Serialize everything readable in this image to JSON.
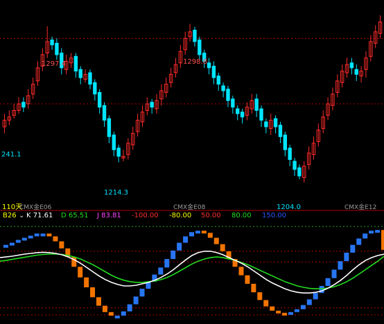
{
  "price_panel": {
    "labels": {
      "high_left": "1297.4",
      "high_mid": "1298.8",
      "low_left": "241.1",
      "low_mid": "1214.3",
      "low_right": "1204.0",
      "scale_label": "110天",
      "period_1": "CMX金E06",
      "period_2": "CMX金E08",
      "period_3": "CMX金E12"
    }
  },
  "indicator_panel": {
    "name": "B26",
    "k_label": "K 71.61",
    "d_label": "D 65.51",
    "j_label": "J 83.81",
    "levels": [
      "-100.00",
      "-80.00",
      "50.00",
      "80.00",
      "150.00"
    ]
  },
  "colors": {
    "background": "#000000",
    "up_candle": "#ff2b2b",
    "down_candle": "#00e5ff",
    "grid_red": "#b00000",
    "grid_green": "#2e9e2e",
    "k_line": "#ffffff",
    "d_line": "#22dd22",
    "j_up": "#2a7bff",
    "j_down": "#ff7a00",
    "label_red": "#ff5050",
    "label_cyan": "#00e5ff",
    "yellow": "#ffff00"
  },
  "chart_data": [
    {
      "type": "candlestick",
      "y_range": [
        1190,
        1310
      ],
      "reference_levels": [
        1290,
        1250
      ],
      "annotations": [
        {
          "text": "1297.4",
          "x": 18,
          "y": 1297.4
        },
        {
          "text": "1298.8",
          "x": 66,
          "y": 1298.8
        },
        {
          "text": "241.1",
          "x": 1,
          "y": 1241.1
        },
        {
          "text": "1214.3",
          "x": 41,
          "y": 1214.3
        },
        {
          "text": "1204.0",
          "x": 101,
          "y": 1204.0
        }
      ],
      "close": [
        1240,
        1242,
        1246,
        1250,
        1248,
        1255,
        1262,
        1272,
        1280,
        1288,
        1286,
        1280,
        1272,
        1276,
        1278,
        1270,
        1266,
        1268,
        1262,
        1256,
        1248,
        1240,
        1230,
        1222,
        1218,
        1218,
        1226,
        1232,
        1240,
        1245,
        1250,
        1248,
        1252,
        1258,
        1262,
        1268,
        1274,
        1282,
        1290,
        1294,
        1288,
        1280,
        1276,
        1272,
        1266,
        1262,
        1258,
        1252,
        1248,
        1244,
        1242,
        1248,
        1252,
        1246,
        1240,
        1236,
        1240,
        1236,
        1230,
        1222,
        1216,
        1210,
        1206,
        1212,
        1220,
        1226,
        1234,
        1242,
        1250,
        1256,
        1264,
        1270,
        1274,
        1272,
        1268,
        1270,
        1278,
        1288,
        1294,
        1300
      ],
      "open": [
        1236,
        1240,
        1243,
        1246,
        1251,
        1250,
        1256,
        1264,
        1273,
        1281,
        1289,
        1287,
        1281,
        1271,
        1275,
        1279,
        1271,
        1265,
        1269,
        1263,
        1257,
        1249,
        1241,
        1231,
        1223,
        1217,
        1219,
        1225,
        1233,
        1239,
        1246,
        1251,
        1247,
        1253,
        1257,
        1263,
        1269,
        1275,
        1283,
        1291,
        1295,
        1289,
        1281,
        1275,
        1273,
        1267,
        1261,
        1259,
        1253,
        1247,
        1245,
        1243,
        1247,
        1253,
        1247,
        1239,
        1235,
        1241,
        1237,
        1231,
        1223,
        1215,
        1211,
        1205,
        1213,
        1219,
        1227,
        1235,
        1243,
        1249,
        1257,
        1263,
        1269,
        1275,
        1271,
        1267,
        1271,
        1279,
        1287,
        1293
      ],
      "high": [
        1244,
        1246,
        1250,
        1254,
        1254,
        1259,
        1266,
        1276,
        1284,
        1297.4,
        1291,
        1290,
        1284,
        1280,
        1281,
        1281,
        1273,
        1271,
        1271,
        1265,
        1259,
        1251,
        1243,
        1233,
        1225,
        1222,
        1229,
        1236,
        1244,
        1249,
        1254,
        1253,
        1256,
        1262,
        1266,
        1272,
        1278,
        1286,
        1294,
        1298.8,
        1297,
        1291,
        1283,
        1278,
        1276,
        1269,
        1263,
        1261,
        1255,
        1249,
        1247,
        1251,
        1256,
        1256,
        1249,
        1241,
        1244,
        1243,
        1239,
        1233,
        1225,
        1217,
        1213,
        1215,
        1224,
        1230,
        1238,
        1246,
        1254,
        1260,
        1268,
        1274,
        1278,
        1278,
        1274,
        1273,
        1282,
        1292,
        1298,
        1304
      ],
      "low": [
        1232,
        1237,
        1241,
        1244,
        1245,
        1247,
        1253,
        1261,
        1270,
        1278,
        1283,
        1277,
        1268,
        1268,
        1272,
        1266,
        1262,
        1263,
        1259,
        1252,
        1244,
        1236,
        1226,
        1218,
        1214.3,
        1215,
        1216,
        1222,
        1230,
        1236,
        1243,
        1244,
        1244,
        1249,
        1254,
        1260,
        1266,
        1272,
        1280,
        1288,
        1285,
        1277,
        1272,
        1268,
        1262,
        1258,
        1254,
        1248,
        1244,
        1240,
        1238,
        1240,
        1244,
        1242,
        1236,
        1232,
        1231,
        1232,
        1226,
        1218,
        1212,
        1206,
        1204.0,
        1202,
        1210,
        1216,
        1224,
        1232,
        1240,
        1246,
        1254,
        1260,
        1266,
        1268,
        1264,
        1263,
        1266,
        1276,
        1284,
        1290
      ]
    },
    {
      "type": "line",
      "title": "B26",
      "y_range": [
        -110,
        160
      ],
      "reference_levels": [
        150,
        80,
        50,
        -80,
        -100
      ],
      "series": [
        {
          "name": "K",
          "last": 71.61,
          "values": [
            62,
            64,
            66,
            69,
            72,
            74,
            76,
            77,
            76,
            74,
            70,
            64,
            56,
            46,
            34,
            22,
            10,
            0,
            -8,
            -14,
            -18,
            -18,
            -16,
            -12,
            -8,
            -2,
            6,
            16,
            28,
            42,
            56,
            68,
            76,
            80,
            80,
            76,
            70,
            62,
            54,
            46,
            36,
            24,
            12,
            0,
            -10,
            -18,
            -26,
            -32,
            -36,
            -38,
            -38,
            -36,
            -32,
            -24,
            -14,
            -2,
            12,
            28,
            42,
            54,
            62,
            68,
            71.61
          ]
        },
        {
          "name": "D",
          "last": 65.51,
          "values": [
            52,
            54,
            57,
            60,
            63,
            66,
            69,
            71,
            72,
            72,
            71,
            68,
            64,
            58,
            50,
            42,
            32,
            22,
            12,
            4,
            -2,
            -6,
            -8,
            -8,
            -6,
            -4,
            0,
            6,
            14,
            24,
            34,
            44,
            52,
            58,
            62,
            64,
            62,
            58,
            54,
            48,
            42,
            34,
            26,
            18,
            10,
            2,
            -6,
            -12,
            -18,
            -22,
            -25,
            -26,
            -26,
            -24,
            -20,
            -14,
            -6,
            4,
            16,
            28,
            40,
            52,
            65.51
          ]
        },
        {
          "name": "J",
          "last": 83.81,
          "values": [
            90,
            98,
            104,
            112,
            118,
            124,
            130,
            130,
            122,
            108,
            88,
            64,
            36,
            6,
            -22,
            -50,
            -74,
            -92,
            -102,
            -102,
            -90,
            -70,
            -48,
            -26,
            -6,
            14,
            34,
            58,
            82,
            104,
            122,
            134,
            138,
            132,
            118,
            100,
            80,
            58,
            36,
            12,
            -12,
            -36,
            -58,
            -76,
            -88,
            -94,
            -96,
            -92,
            -84,
            -72,
            -56,
            -38,
            -18,
            4,
            28,
            52,
            76,
            98,
            116,
            130,
            138,
            140,
            83.81
          ]
        }
      ]
    }
  ]
}
